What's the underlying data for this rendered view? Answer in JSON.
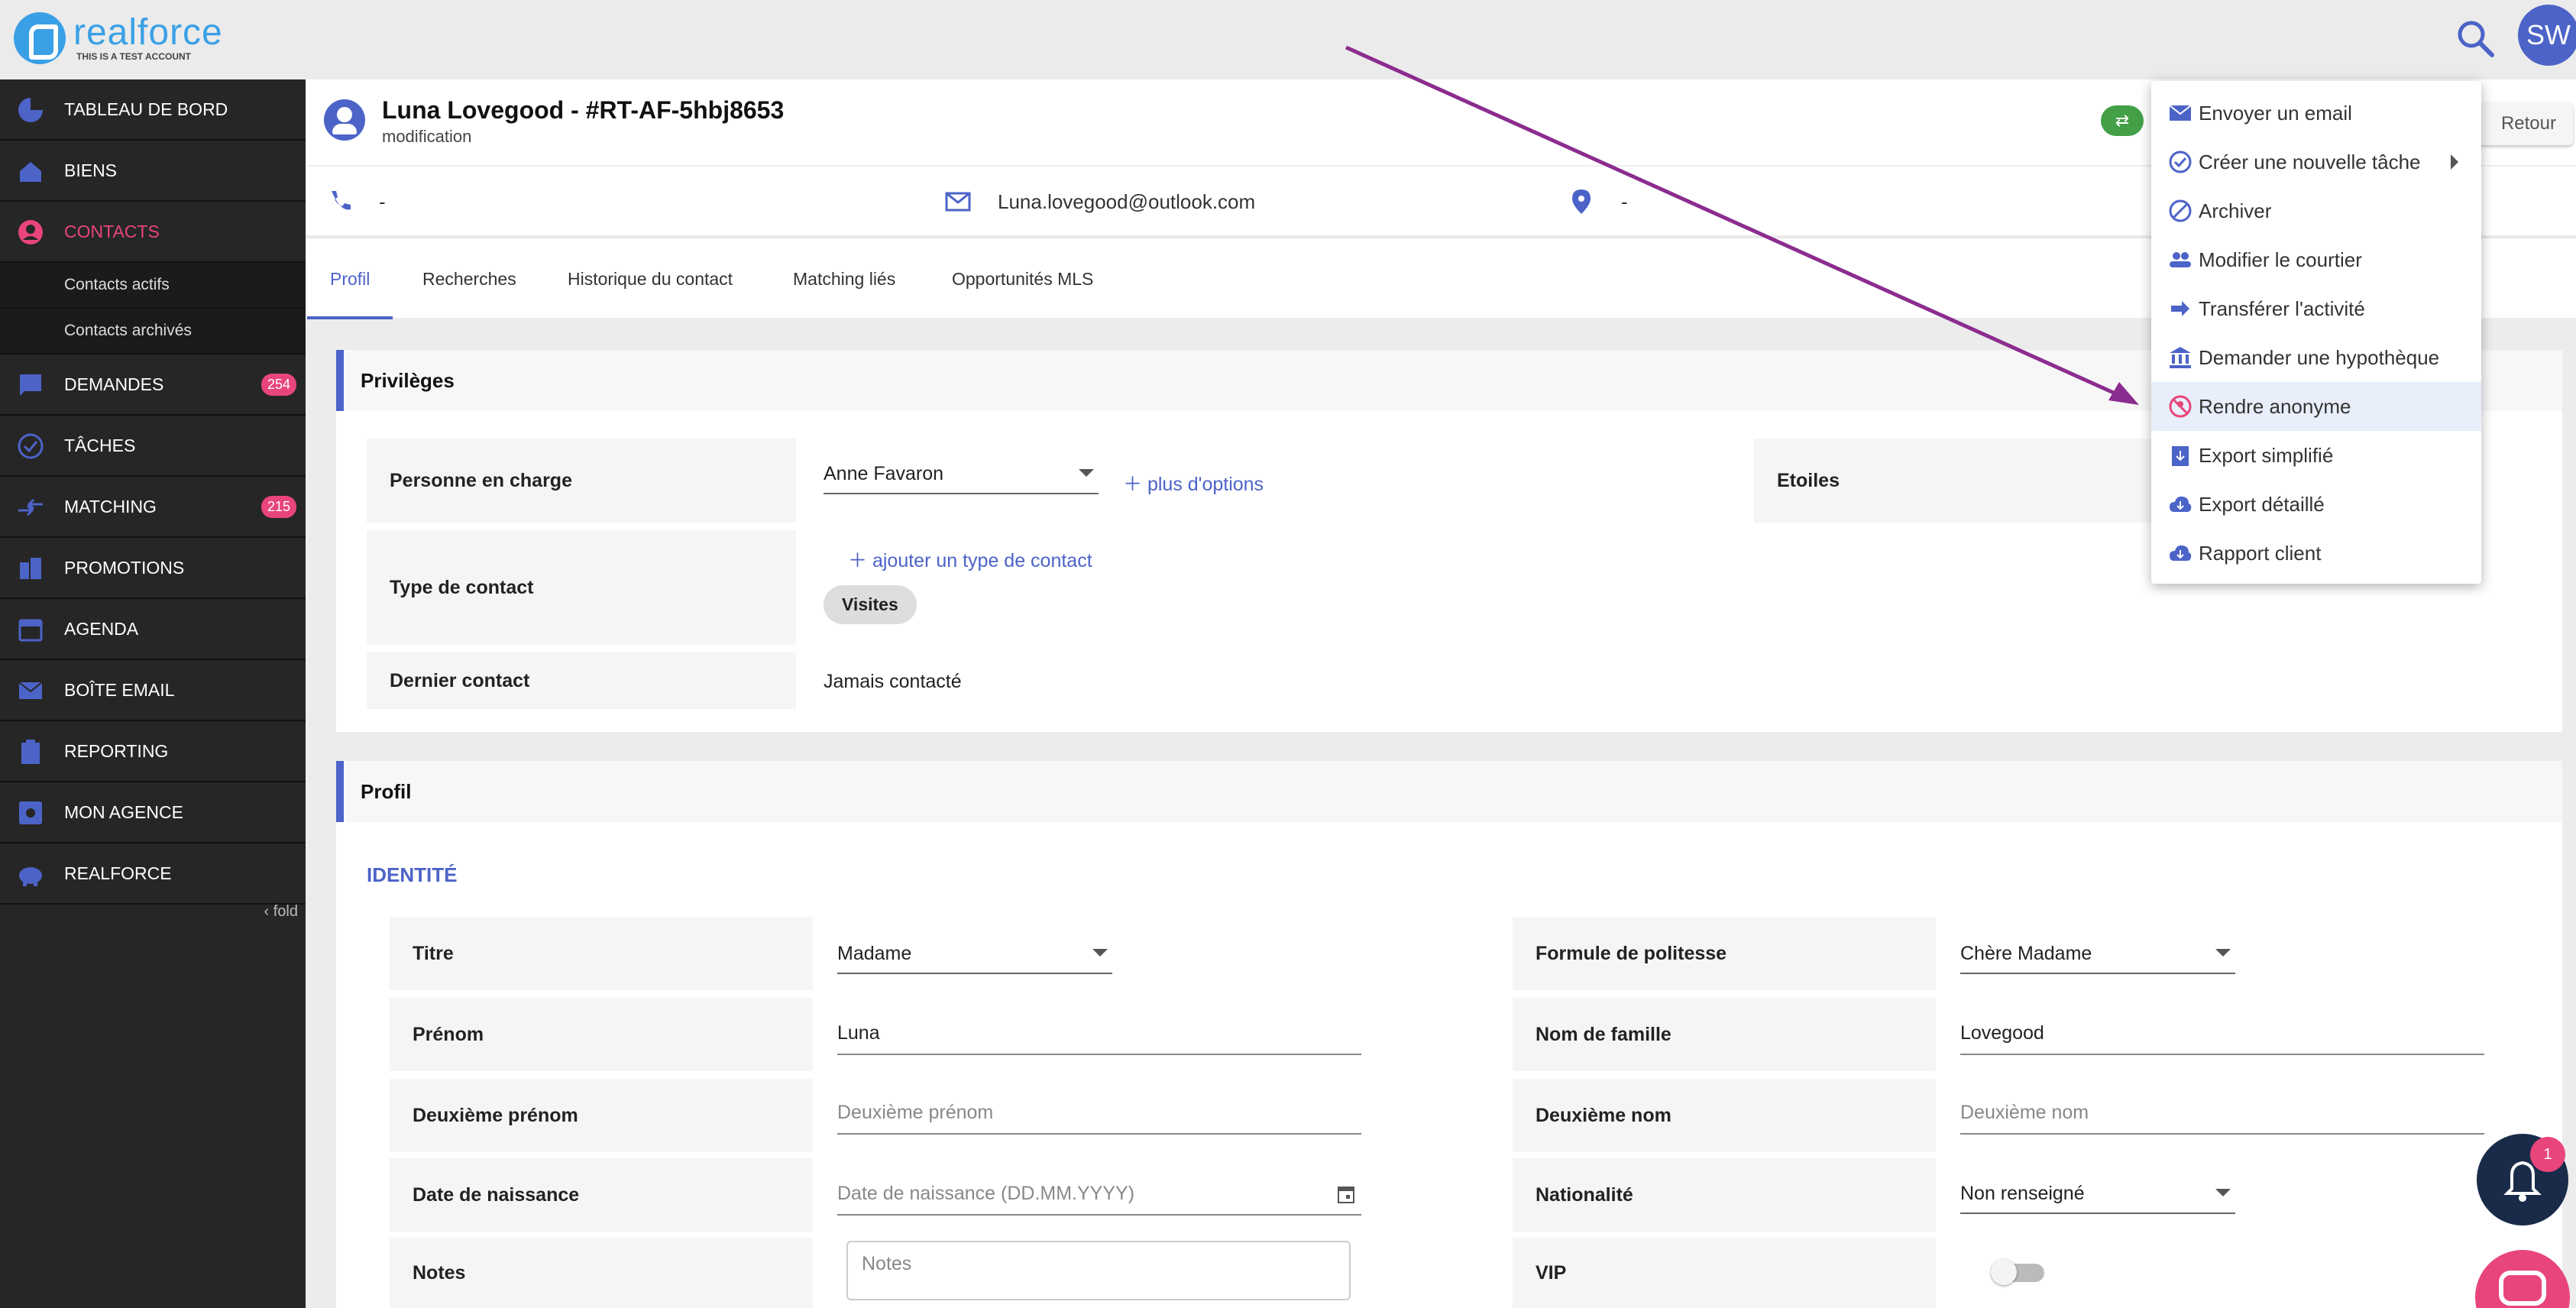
{
  "brand": {
    "name": "realforce",
    "subtitle": "THIS IS A TEST ACCOUNT"
  },
  "user": {
    "initials": "SW"
  },
  "sidebar": {
    "items": [
      {
        "label": "TABLEAU DE BORD",
        "icon": "pie-chart-icon"
      },
      {
        "label": "BIENS",
        "icon": "house-icon"
      },
      {
        "label": "CONTACTS",
        "icon": "person-icon",
        "active": true
      },
      {
        "label": "DEMANDES",
        "icon": "message-icon",
        "badge": "254"
      },
      {
        "label": "TÂCHES",
        "icon": "check-circle-icon"
      },
      {
        "label": "MATCHING",
        "icon": "compare-arrows-icon",
        "badge": "215"
      },
      {
        "label": "PROMOTIONS",
        "icon": "building-icon"
      },
      {
        "label": "AGENDA",
        "icon": "calendar-icon"
      },
      {
        "label": "BOÎTE EMAIL",
        "icon": "mail-icon"
      },
      {
        "label": "REPORTING",
        "icon": "clipboard-icon"
      },
      {
        "label": "MON AGENCE",
        "icon": "settings-box-icon"
      },
      {
        "label": "REALFORCE",
        "icon": "piggy-bank-icon"
      }
    ],
    "sub_items": [
      "Contacts actifs",
      "Contacts archivés"
    ],
    "fold_label": "fold"
  },
  "header": {
    "title": "Luna Lovegood - #RT-AF-5hbj8653",
    "subtitle": "modification",
    "retour_label": "Retour",
    "phone": "-",
    "email": "Luna.lovegood@outlook.com",
    "location": "-"
  },
  "tabs": [
    "Profil",
    "Recherches",
    "Historique du contact",
    "Matching liés",
    "Opportunités MLS"
  ],
  "privileges": {
    "title": "Privilèges",
    "person_label": "Personne en charge",
    "person_value": "Anne Favaron",
    "more_options": "plus d'options",
    "stars_label": "Etoiles",
    "contact_type_label": "Type de contact",
    "add_type": "ajouter un type de contact",
    "chip": "Visites",
    "last_contact_label": "Dernier contact",
    "last_contact_value": "Jamais contacté"
  },
  "profil": {
    "title": "Profil",
    "section": "IDENTITÉ",
    "titre_label": "Titre",
    "titre_value": "Madame",
    "politesse_label": "Formule de politesse",
    "politesse_value": "Chère Madame",
    "prenom_label": "Prénom",
    "prenom_value": "Luna",
    "nom_label": "Nom de famille",
    "nom_value": "Lovegood",
    "deux_prenom_label": "Deuxième prénom",
    "deux_prenom_placeholder": "Deuxième prénom",
    "deux_nom_label": "Deuxième nom",
    "deux_nom_placeholder": "Deuxième nom",
    "naissance_label": "Date de naissance",
    "naissance_placeholder": "Date de naissance (DD.MM.YYYY)",
    "nationalite_label": "Nationalité",
    "nationalite_value": "Non renseigné",
    "notes_label": "Notes",
    "notes_placeholder": "Notes",
    "vip_label": "VIP"
  },
  "menu": {
    "items": [
      {
        "label": "Envoyer un email",
        "icon": "mail-icon"
      },
      {
        "label": "Créer une nouvelle tâche",
        "icon": "check-circle-icon",
        "submenu": true
      },
      {
        "label": "Archiver",
        "icon": "block-icon"
      },
      {
        "label": "Modifier le courtier",
        "icon": "people-icon"
      },
      {
        "label": "Transférer l'activité",
        "icon": "forward-arrow-icon"
      },
      {
        "label": "Demander une hypothèque",
        "icon": "bank-icon"
      },
      {
        "label": "Rendre anonyme",
        "icon": "anonymous-icon",
        "highlighted": true
      },
      {
        "label": "Export simplifié",
        "icon": "clipboard-download-icon"
      },
      {
        "label": "Export détaillé",
        "icon": "cloud-download-icon"
      },
      {
        "label": "Rapport client",
        "icon": "cloud-download-icon"
      }
    ]
  },
  "notifications": {
    "count": "1"
  },
  "colors": {
    "accent": "#4c63c8",
    "active": "#e8457a",
    "sidebar": "#262626",
    "annotation_arrow": "#8b2c8f"
  }
}
